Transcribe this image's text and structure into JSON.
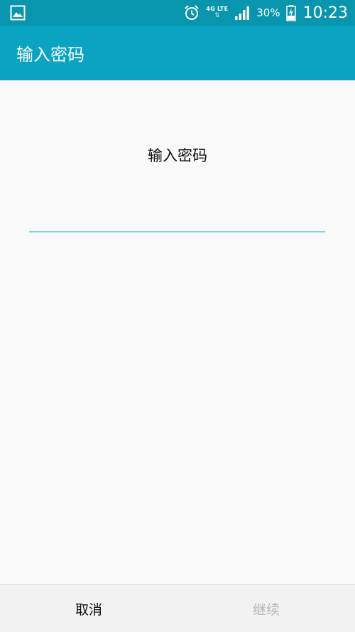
{
  "status_bar": {
    "network_label": "4G LTE",
    "data_arrows": "⇅",
    "battery_percent": "30%",
    "time": "10:23",
    "icons": [
      "gallery-icon",
      "alarm-icon",
      "signal-icon",
      "battery-charging-icon"
    ]
  },
  "app_bar": {
    "title": "输入密码"
  },
  "content": {
    "prompt": "输入密码",
    "password_value": "",
    "accent_color": "#7fd3e6"
  },
  "bottom_bar": {
    "cancel_label": "取消",
    "continue_label": "继续"
  },
  "colors": {
    "status_bar": "#0895ae",
    "app_bar": "#0aa4c2",
    "background": "#f9f9f9"
  }
}
